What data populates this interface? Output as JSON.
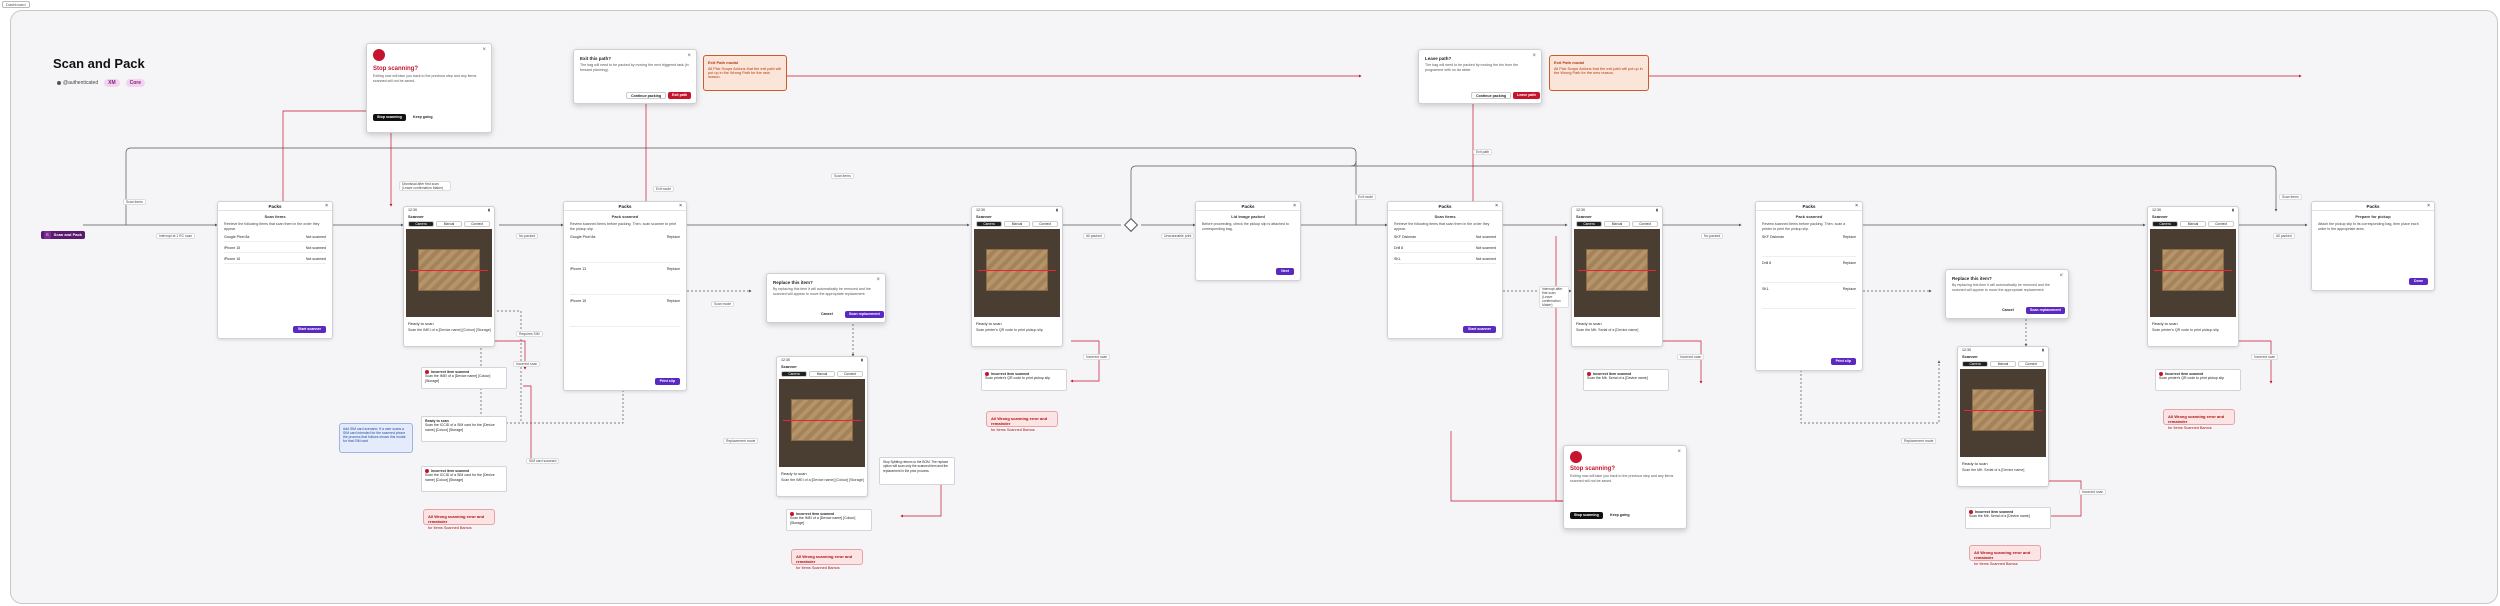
{
  "frame_tag": "Dashboard",
  "page": {
    "title": "Scan and Pack",
    "owner": "@authenticated",
    "pills": [
      "XM",
      "Core"
    ]
  },
  "start": {
    "label": "Scan and Pack",
    "icon_text": "S"
  },
  "modals": {
    "stop1": {
      "title": "Stop scanning?",
      "desc": "Exiting now will take you back to the previous step and any items scanned will not be saved.",
      "primary": "Stop scanning",
      "secondary": "Keep going"
    },
    "exit1": {
      "title": "Exit this path?",
      "desc": "The bag will need to be packed by moving the next triggered task (in forward planning).",
      "secondary": "Continue packing",
      "primary": "Exit path"
    },
    "exit1_err": {
      "title": "Exit Path modal",
      "body": "All Pick Scope Actions that the exit path will put up in the Wrong Path for the new reason."
    },
    "leave2": {
      "title": "Leave path?",
      "desc": "The bag will need to be packed by moving the bin from the programme with no far wider.",
      "secondary": "Continue packing",
      "primary": "Leave path"
    },
    "leave2_err": {
      "title": "Exit Path modal",
      "body": "All Pick Scope Actions that the exit path will put up in the Wrong Path for the new reason."
    },
    "replace1": {
      "title": "Replace this item?",
      "desc": "By replacing this item it will automatically be removed and the scanned will appear to move the appropriate replacement.",
      "secondary": "Cancel",
      "primary": "Scan replacement"
    },
    "replace2": {
      "title": "Replace this item?",
      "desc": "By replacing this item it will automatically be removed and the scanned will appear to move the appropriate replacement.",
      "secondary": "Cancel",
      "primary": "Scan replacement"
    },
    "stop2": {
      "title": "Stop scanning?",
      "desc": "Exiting now will take you back to the previous step and any items scanned will not be saved.",
      "primary": "Stop scanning",
      "secondary": "Keep going"
    }
  },
  "cards": {
    "scan_items1": {
      "header": "Packs",
      "sub": "Scan items",
      "desc": "Retrieve the following items that scan them in the order they appear.",
      "rows": [
        [
          "Google Pixel 8a",
          "Not scanned"
        ],
        [
          "iPhone 15",
          "Not scanned"
        ],
        [
          "iPhone 15",
          "Not scanned"
        ]
      ],
      "btn": "Start scanner"
    },
    "pack_scanned": {
      "header": "Packs",
      "sub": "Pack scanned",
      "desc": "Review scanned items before packing. Then, scan scanner to print the pickup slip.",
      "rows": [
        [
          "Google Pixel 8a",
          "Replace"
        ],
        [
          "iPhone 13",
          "Replace"
        ],
        [
          "iPhone 15",
          "Replace"
        ]
      ],
      "btn": "Print slip"
    },
    "print": {
      "header": "Packs",
      "sub": "Lid image packed",
      "desc": "Before proceeding, check the pickup slip is attached to corresponding bag.",
      "btn": "Next"
    },
    "scan_items2": {
      "header": "Packs",
      "sub": "Scan items",
      "desc": "Retrieve the following items that scan them in the order they appear.",
      "rows": [
        [
          "SKF Dishman",
          "Not scanned"
        ],
        [
          "Drill 8",
          "Not scanned"
        ],
        [
          "SKL",
          "Not scanned"
        ]
      ],
      "btn": "Start scanner"
    },
    "pack_scanned2": {
      "header": "Packs",
      "sub": "Pack scanned",
      "desc": "Review scanned items before packing. Then, scan a printer to print the pickup slip.",
      "rows": [
        [
          "SKF Dishman",
          "Replace"
        ],
        [
          "Drill 8",
          "Replace"
        ],
        [
          "SKL",
          "Replace"
        ]
      ],
      "btn": "Print slip"
    },
    "prepare": {
      "header": "Packs",
      "sub": "Prepare for pickup",
      "desc": "Attach the pickup slip to its corresponding bag, then place each order in the appropriate area.",
      "btn": "Done"
    }
  },
  "phones": {
    "p1": {
      "time": "12:30",
      "nav": "Scanner",
      "seg": [
        "Camera",
        "Manual",
        "Connect"
      ],
      "ready": "Ready to scan",
      "hint": "Scan the IMEI of a [Device name] [Colour] [Storage]",
      "count": "0 of 3 items"
    },
    "p2": {
      "time": "12:30",
      "nav": "Scanner",
      "seg": [
        "Camera",
        "Manual",
        "Connect"
      ],
      "ready": "Ready to scan",
      "hint": "Scan printer's QR code to print pickup slip",
      "count": ""
    },
    "p3": {
      "time": "12:30",
      "nav": "Scanner",
      "seg": [
        "Camera",
        "Manual",
        "Connect"
      ],
      "ready": "Ready to scan",
      "hint": "Scan the IMEI of a [Device name] [Colour] [Storage]",
      "count": "0 of 1 items"
    },
    "p4": {
      "time": "12:30",
      "nav": "Scanner",
      "seg": [
        "Camera",
        "Manual",
        "Connect"
      ],
      "ready": "Ready to scan",
      "hint": "Scan the Mfr. Serial of a [Device name]",
      "count": "0 of 3 items"
    },
    "p5": {
      "time": "12:30",
      "nav": "Scanner",
      "seg": [
        "Camera",
        "Manual",
        "Connect"
      ],
      "ready": "Ready to scan",
      "hint": "Scan printer's QR code to print pickup slip",
      "count": ""
    },
    "p6": {
      "time": "12:30",
      "nav": "Scanner",
      "seg": [
        "Camera",
        "Manual",
        "Connect"
      ],
      "ready": "Ready to scan",
      "hint": "Scan the Mfr. Serial of a [Device name]",
      "count": "0 of 1 items"
    }
  },
  "minis": {
    "m1": {
      "title": "Incorrect item scanned",
      "body": "Scan the IMEI of a [Device name] [Colour] [Storage]"
    },
    "m2": {
      "title": "Ready to scan",
      "body": "Scan the ICCID of a SIM card for the [Device name] [Colour] [Storage]"
    },
    "m3": {
      "title": "Incorrect item scanned",
      "body": "Scan the ICCID of a SIM card for the [Device name] [Colour] [Storage]"
    },
    "m4": {
      "title": "Incorrect item scanned",
      "body": "Scan printer's QR code to print pickup slip"
    },
    "m5": {
      "title": "Incorrect item scanned",
      "body": "Scan the IMEI of a [Device name] [Colour] [Storage]"
    },
    "m6": {
      "title": "Incorrect item scanned",
      "body": "Scan the Mfr. Serial of a [Device name]"
    },
    "m7": {
      "title": "Incorrect item scanned",
      "body": "Scan printer's QR code to print pickup slip"
    },
    "m8": {
      "title": "Incorrect item scanned",
      "body": "Scan the Mfr. Serial of a [Device name]"
    }
  },
  "errors": {
    "e1": {
      "title": "All Wrong scanning error and remainder",
      "body": "for Items Scanned Bamos"
    },
    "e2": {
      "title": "All Wrong scanning error and remainder",
      "body": "for Items Scanned Bamos"
    },
    "e3": {
      "title": "All Wrong scanning error and remainder",
      "body": "for Items Scanned Bamos"
    },
    "e4": {
      "title": "All Wrong scanning error and remainder",
      "body": "for Items Scanned Bamos"
    },
    "e5": {
      "title": "All Wrong scanning error and remainder",
      "body": "for Items Scanned Bamos"
    }
  },
  "info": {
    "text": "Add SIM card scenario: If a user scans a SIM card intended for the scanned phone the process that follows shows this modal for that SIM card"
  },
  "note": {
    "text": "Stop Splitting returns to the BOM. The replace option will scan only the scanned item and the replacement in the prior process."
  },
  "labels": {
    "l1": "Scan items",
    "l2": "Interrupt at 1 RC scan",
    "l3": "No packed",
    "l4": "Dismissal after first scan (Leave confirmation Maker)",
    "l5": "Requires SIM",
    "l6": "Incorrect scan",
    "l7": "SIM card scanned",
    "l8": "Exit mode",
    "l9": "Scan mode",
    "l10": "Replacement mode",
    "l11": "Incorrect scan",
    "l12": "All packed",
    "l13": "Unscannable print",
    "l14": "Exit path",
    "l15": "Scan items",
    "l16": "Exit mode",
    "l17": "Scan items",
    "l18": "Interrupt after first scan (Leave confirmation Maker)",
    "l19": "No packed",
    "l20": "Incorrect scan",
    "l21": "Replacement mode",
    "l22": "Incorrect scan",
    "l23": "All packed",
    "l24": "Incorrect scan"
  },
  "colors": {
    "accent": "#5a2ac0",
    "danger": "#c4142e",
    "pill": "#f3d3ef",
    "error_bg": "#fce3e4",
    "info_bg": "#e4ecfb"
  }
}
